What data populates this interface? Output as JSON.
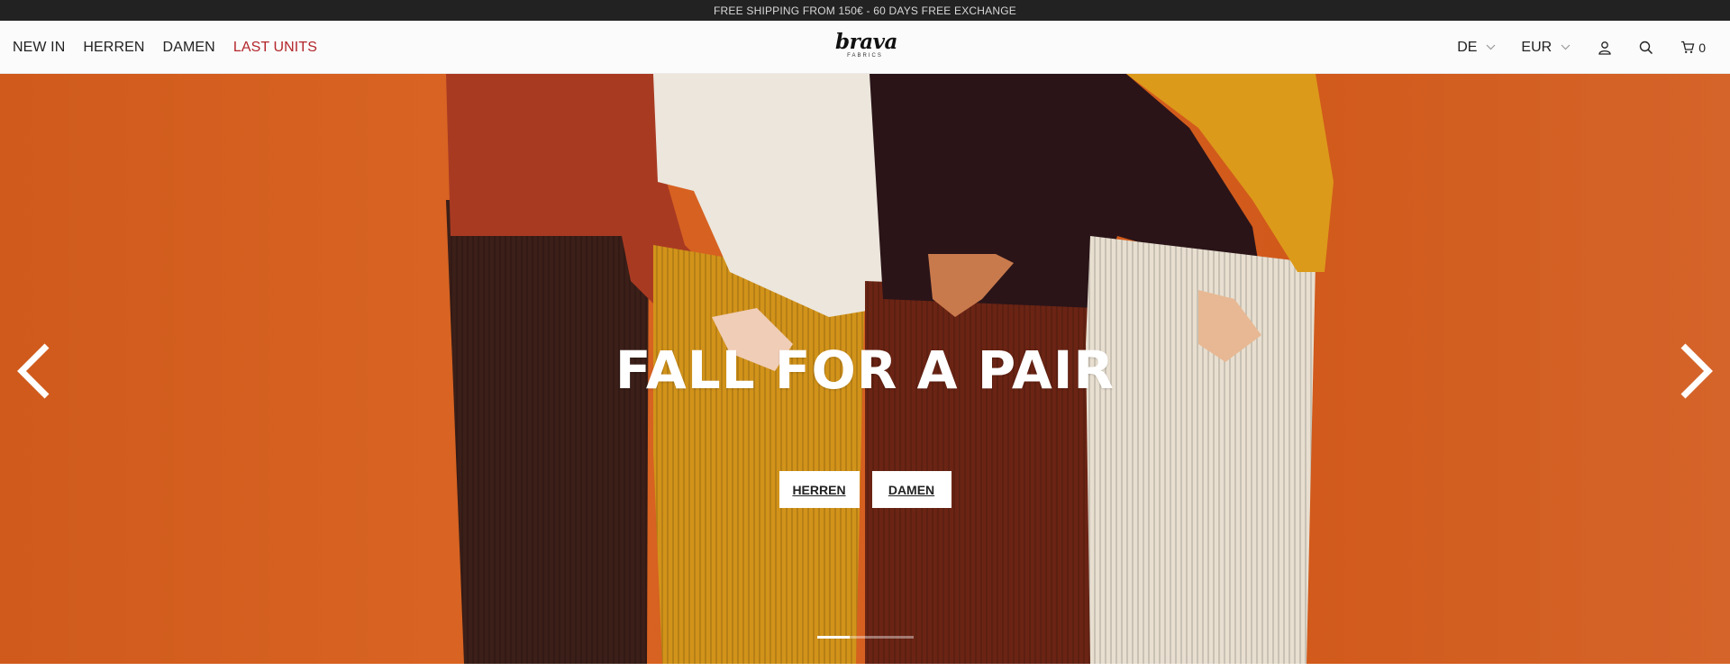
{
  "announcement": "FREE SHIPPING FROM 150€ - 60 DAYS FREE EXCHANGE",
  "nav": {
    "items": [
      {
        "label": "NEW IN"
      },
      {
        "label": "HERREN"
      },
      {
        "label": "DAMEN"
      },
      {
        "label": "LAST UNITS"
      }
    ]
  },
  "logo": {
    "word": "brava",
    "sub": "FABRICS"
  },
  "header_right": {
    "language": "DE",
    "currency": "EUR",
    "cart_count": "0",
    "icons": [
      "account-icon",
      "search-icon",
      "cart-icon"
    ]
  },
  "hero": {
    "title": "FALL FOR A PAIR",
    "buttons": [
      {
        "label": "HERREN"
      },
      {
        "label": "DAMEN"
      }
    ],
    "slides": 3,
    "active_slide": 1
  },
  "colors": {
    "background_orange": "#d66020",
    "accent_red": "#b3262b",
    "topbar": "#222222"
  }
}
